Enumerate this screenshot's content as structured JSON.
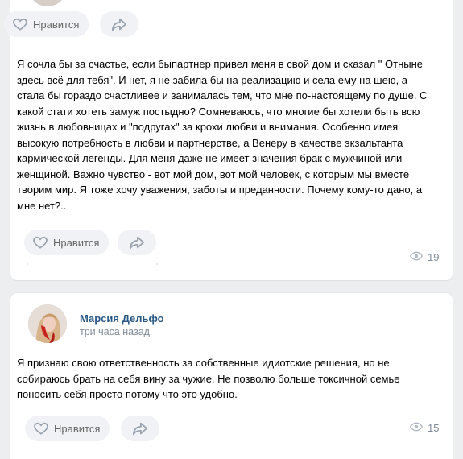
{
  "post1": {
    "like_label": "Нравится",
    "text": "Я сочла бы за счастье, если бы​партнер привел меня в свой дом и сказал \" Отныне здесь всё для тебя\". И нет, я не забила бы на реализацию и села ему на шею, а стала бы гораздо счастливее и занималась тем, что мне по-настоящему по душе. С какой стати хотеть замуж постыдно? Сомневаюсь, что многие бы хотели быть всю жизнь в любовницах и \"подругах\" за крохи любви и внимания. Особенно имея высокую потребность в любви и партнерстве, а Венеру в качестве экзальтанта кармической легенды. Для меня даже не имеет значения брак с мужчиной или женщиной. Важно чувство - вот мой дом, вот мой человек, с которым мы вместе творим мир. Я тоже хочу уважения, заботы и преданности. Почему кому-то дано, а мне нет?..",
    "views": "19"
  },
  "post2": {
    "author": "Марсия Дельфо",
    "time": "три часа назад",
    "text": "Я признаю свою ответственность за собственные идиотские решения, но не собираюсь брать на себя вину за чужие. Не позволю больше токсичной семье поносить себя просто потому что это удобно.",
    "like_label": "Нравится",
    "views": "15"
  },
  "top_bar": {
    "like_label": "Нравится"
  },
  "icons": {
    "like": "heart-icon",
    "share": "share-arrow-icon",
    "views": "eye-icon"
  },
  "colors": {
    "background": "#edeef0",
    "card": "#ffffff",
    "author_link": "#2a5885",
    "muted": "#818c99",
    "button_bg": "#f0f2f5"
  }
}
